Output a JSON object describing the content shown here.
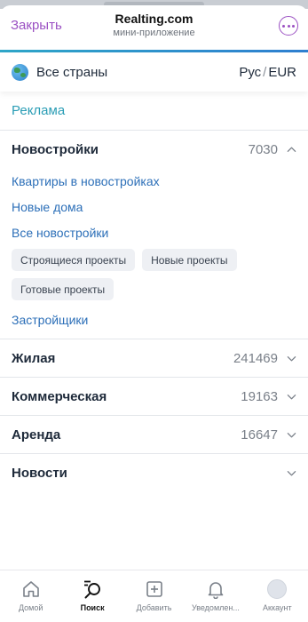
{
  "header": {
    "close_label": "Закрыть",
    "title": "Realting.com",
    "subtitle": "мини-приложение"
  },
  "country_bar": {
    "country": "Все страны",
    "lang": "Рус",
    "separator": "/",
    "currency": "EUR"
  },
  "ads": {
    "label": "Реклама"
  },
  "new_buildings": {
    "label": "Новостройки",
    "count": "7030",
    "expanded": true,
    "links": [
      "Квартиры в новостройках",
      "Новые дома",
      "Все новостройки"
    ],
    "chips": [
      "Строящиеся проекты",
      "Новые проекты",
      "Готовые проекты"
    ],
    "developers_link": "Застройщики"
  },
  "sections": [
    {
      "label": "Жилая",
      "count": "241469"
    },
    {
      "label": "Коммерческая",
      "count": "19163"
    },
    {
      "label": "Аренда",
      "count": "16647"
    },
    {
      "label": "Новости",
      "count": ""
    }
  ],
  "tabbar": {
    "items": [
      {
        "label": "Домой",
        "icon": "home-icon"
      },
      {
        "label": "Поиск",
        "icon": "search-icon",
        "active": true
      },
      {
        "label": "Добавить",
        "icon": "add-icon"
      },
      {
        "label": "Уведомлен...",
        "icon": "bell-icon"
      },
      {
        "label": "Аккаунт",
        "icon": "avatar"
      }
    ]
  },
  "colors": {
    "accent_purple": "#9b51c3",
    "link_blue": "#2c6fb8",
    "teal": "#2a9db5"
  }
}
